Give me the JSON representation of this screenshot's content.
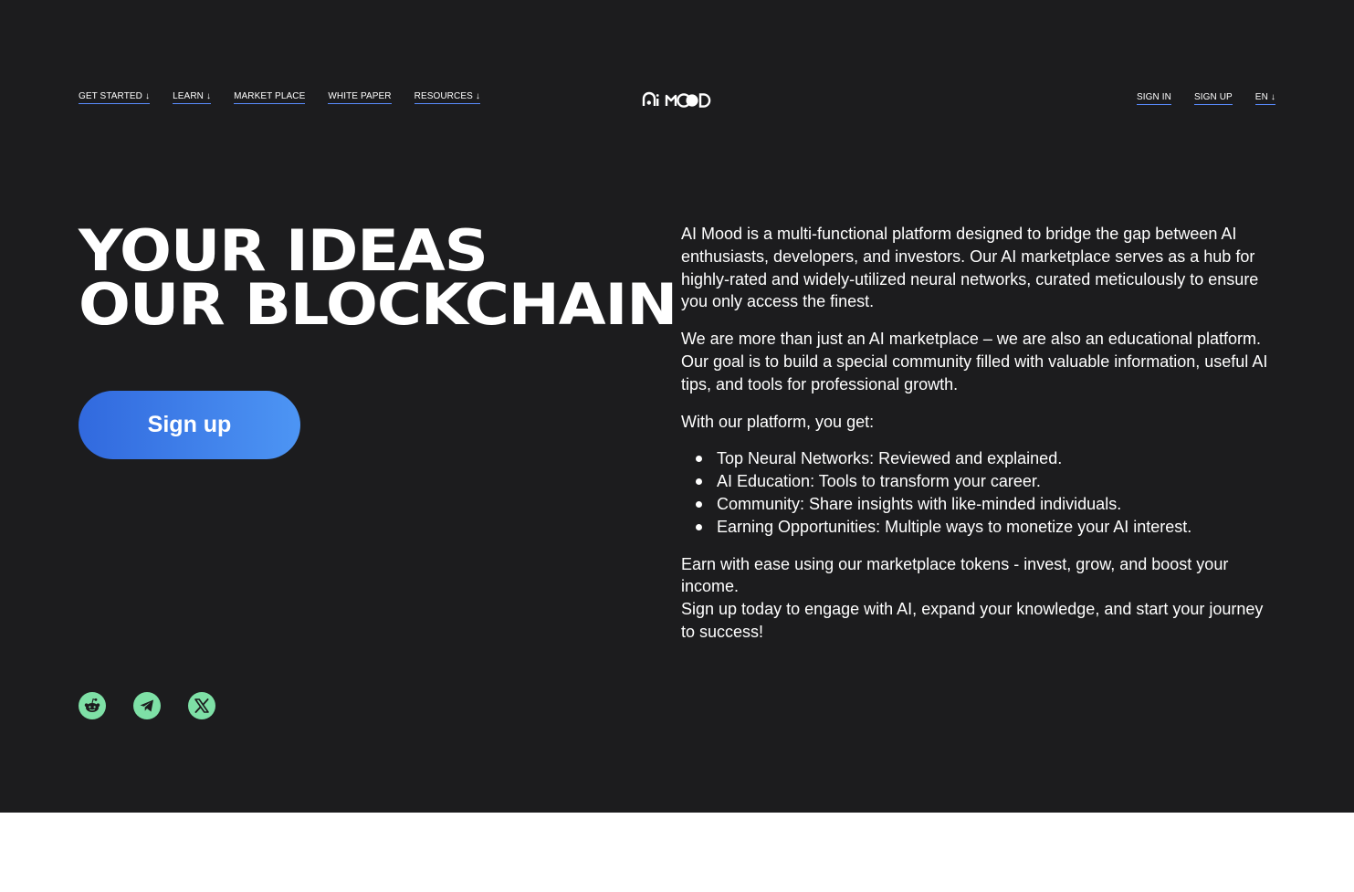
{
  "nav": {
    "left": [
      {
        "label": "GET STARTED",
        "arrow": "↓"
      },
      {
        "label": "LEARN",
        "arrow": "↓"
      },
      {
        "label": "MARKET PLACE",
        "arrow": ""
      },
      {
        "label": "WHITE PAPER",
        "arrow": ""
      },
      {
        "label": "RESOURCES",
        "arrow": "↓"
      }
    ],
    "logo_text": "AI MOOD",
    "right": [
      {
        "label": "SIGN IN",
        "arrow": ""
      },
      {
        "label": "SIGN UP",
        "arrow": ""
      },
      {
        "label": "EN",
        "arrow": "↓"
      }
    ]
  },
  "hero": {
    "headline_line1": "YOUR IDEAS",
    "headline_line2": "OUR BLOCKCHAIN",
    "cta_label": "Sign up"
  },
  "socials": [
    {
      "icon": "reddit-icon"
    },
    {
      "icon": "telegram-icon"
    },
    {
      "icon": "x-icon"
    }
  ],
  "about": {
    "p1": "AI Mood is a multi-functional platform designed to bridge the gap between AI enthusiasts, developers, and investors. Our AI marketplace serves as a hub for highly-rated and widely-utilized neural networks, curated meticulously to ensure you only access the finest.",
    "p2": "We are more than just an AI marketplace – we are also an educational platform. Our goal is to build a special community filled with valuable information, useful AI tips, and tools for professional growth.",
    "p3": "With our platform, you get:",
    "bullets": [
      "Top Neural Networks: Reviewed and explained.",
      "AI Education: Tools to transform your career.",
      "Community: Share insights with like-minded individuals.",
      "Earning Opportunities: Multiple ways to monetize your AI interest."
    ],
    "p4": "Earn with ease using our marketplace tokens - invest, grow, and boost your income.",
    "p5": "Sign up today to engage with AI, expand your knowledge, and start your journey to success!"
  },
  "colors": {
    "background": "#1c1c1e",
    "accent_gradient_start": "#3169de",
    "accent_gradient_end": "#4d95f4",
    "social_icon_bg": "#7ee0a6",
    "nav_underline": "#5a8cff"
  }
}
